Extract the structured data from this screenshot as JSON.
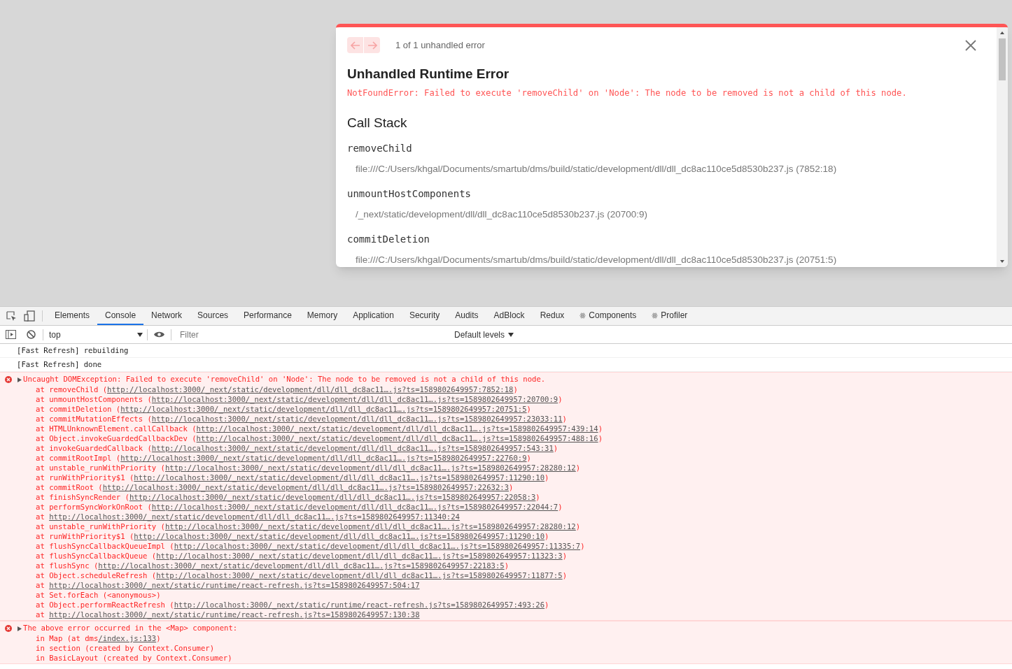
{
  "overlay": {
    "pagination": "1 of 1 unhandled error",
    "title": "Unhandled Runtime Error",
    "message": "NotFoundError: Failed to execute 'removeChild' on 'Node': The node to be removed is not a child of this node.",
    "section_title": "Call Stack",
    "frames": [
      {
        "name": "removeChild",
        "file": "file:///C:/Users/khgal/Documents/smartub/dms/build/static/development/dll/dll_dc8ac110ce5d8530b237.js (7852:18)"
      },
      {
        "name": "unmountHostComponents",
        "file": "/_next/static/development/dll/dll_dc8ac110ce5d8530b237.js (20700:9)"
      },
      {
        "name": "commitDeletion",
        "file": "file:///C:/Users/khgal/Documents/smartub/dms/build/static/development/dll/dll_dc8ac110ce5d8530b237.js (20751:5)"
      }
    ]
  },
  "devtools": {
    "tabs": [
      {
        "label": "Elements",
        "selected": false
      },
      {
        "label": "Console",
        "selected": true
      },
      {
        "label": "Network",
        "selected": false
      },
      {
        "label": "Sources",
        "selected": false
      },
      {
        "label": "Performance",
        "selected": false
      },
      {
        "label": "Memory",
        "selected": false
      },
      {
        "label": "Application",
        "selected": false
      },
      {
        "label": "Security",
        "selected": false
      },
      {
        "label": "Audits",
        "selected": false
      },
      {
        "label": "AdBlock",
        "selected": false
      },
      {
        "label": "Redux",
        "selected": false
      },
      {
        "label": "Components",
        "selected": false,
        "kind": "react"
      },
      {
        "label": "Profiler",
        "selected": false,
        "kind": "react"
      }
    ],
    "context": "top",
    "filter_placeholder": "Filter",
    "levels": "Default levels",
    "messages": [
      {
        "kind": "log",
        "text": "[Fast Refresh] rebuilding"
      },
      {
        "kind": "log",
        "text": "[Fast Refresh] done"
      },
      {
        "kind": "error",
        "text": "Uncaught DOMException: Failed to execute 'removeChild' on 'Node': The node to be removed is not a child of this node.",
        "lines": [
          {
            "before": "at removeChild (",
            "link": "http://localhost:3000/_next/static/development/dll/dll_dc8ac11….js?ts=1589802649957:7852:18",
            "after": ")"
          },
          {
            "before": "at unmountHostComponents (",
            "link": "http://localhost:3000/_next/static/development/dll/dll_dc8ac11….js?ts=1589802649957:20700:9",
            "after": ")"
          },
          {
            "before": "at commitDeletion (",
            "link": "http://localhost:3000/_next/static/development/dll/dll_dc8ac11….js?ts=1589802649957:20751:5",
            "after": ")"
          },
          {
            "before": "at commitMutationEffects (",
            "link": "http://localhost:3000/_next/static/development/dll/dll_dc8ac11….js?ts=1589802649957:23033:11",
            "after": ")"
          },
          {
            "before": "at HTMLUnknownElement.callCallback (",
            "link": "http://localhost:3000/_next/static/development/dll/dll_dc8ac11….js?ts=1589802649957:439:14",
            "after": ")"
          },
          {
            "before": "at Object.invokeGuardedCallbackDev (",
            "link": "http://localhost:3000/_next/static/development/dll/dll_dc8ac11….js?ts=1589802649957:488:16",
            "after": ")"
          },
          {
            "before": "at invokeGuardedCallback (",
            "link": "http://localhost:3000/_next/static/development/dll/dll_dc8ac11….js?ts=1589802649957:543:31",
            "after": ")"
          },
          {
            "before": "at commitRootImpl (",
            "link": "http://localhost:3000/_next/static/development/dll/dll_dc8ac11….js?ts=1589802649957:22760:9",
            "after": ")"
          },
          {
            "before": "at unstable_runWithPriority (",
            "link": "http://localhost:3000/_next/static/development/dll/dll_dc8ac11….js?ts=1589802649957:28280:12",
            "after": ")"
          },
          {
            "before": "at runWithPriority$1 (",
            "link": "http://localhost:3000/_next/static/development/dll/dll_dc8ac11….js?ts=1589802649957:11290:10",
            "after": ")"
          },
          {
            "before": "at commitRoot (",
            "link": "http://localhost:3000/_next/static/development/dll/dll_dc8ac11….js?ts=1589802649957:22632:3",
            "after": ")"
          },
          {
            "before": "at finishSyncRender (",
            "link": "http://localhost:3000/_next/static/development/dll/dll_dc8ac11….js?ts=1589802649957:22058:3",
            "after": ")"
          },
          {
            "before": "at performSyncWorkOnRoot (",
            "link": "http://localhost:3000/_next/static/development/dll/dll_dc8ac11….js?ts=1589802649957:22044:7",
            "after": ")"
          },
          {
            "before": "at ",
            "link": "http://localhost:3000/_next/static/development/dll/dll_dc8ac11….js?ts=1589802649957:11340:24"
          },
          {
            "before": "at unstable_runWithPriority (",
            "link": "http://localhost:3000/_next/static/development/dll/dll_dc8ac11….js?ts=1589802649957:28280:12",
            "after": ")"
          },
          {
            "before": "at runWithPriority$1 (",
            "link": "http://localhost:3000/_next/static/development/dll/dll_dc8ac11….js?ts=1589802649957:11290:10",
            "after": ")"
          },
          {
            "before": "at flushSyncCallbackQueueImpl (",
            "link": "http://localhost:3000/_next/static/development/dll/dll_dc8ac11….js?ts=1589802649957:11335:7",
            "after": ")"
          },
          {
            "before": "at flushSyncCallbackQueue (",
            "link": "http://localhost:3000/_next/static/development/dll/dll_dc8ac11….js?ts=1589802649957:11323:3",
            "after": ")"
          },
          {
            "before": "at flushSync (",
            "link": "http://localhost:3000/_next/static/development/dll/dll_dc8ac11….js?ts=1589802649957:22183:5",
            "after": ")"
          },
          {
            "before": "at Object.scheduleRefresh (",
            "link": "http://localhost:3000/_next/static/development/dll/dll_dc8ac11….js?ts=1589802649957:11877:5",
            "after": ")"
          },
          {
            "before": "at ",
            "link": "http://localhost:3000/_next/static/runtime/react-refresh.js?ts=1589802649957:504:17"
          },
          {
            "before": "at Set.forEach (<anonymous>)"
          },
          {
            "before": "at Object.performReactRefresh (",
            "link": "http://localhost:3000/_next/static/runtime/react-refresh.js?ts=1589802649957:493:26",
            "after": ")"
          },
          {
            "before": "at ",
            "link": "http://localhost:3000/_next/static/runtime/react-refresh.js?ts=1589802649957:130:38"
          }
        ]
      },
      {
        "kind": "error",
        "text": "The above error occurred in the <Map> component:",
        "lines": [
          {
            "before": "in Map (at dms",
            "link": "/index.js:133",
            "after": ")"
          },
          {
            "before": "in section (created by Context.Consumer)"
          },
          {
            "before": "in BasicLayout (created by Context.Consumer)"
          }
        ]
      }
    ]
  }
}
